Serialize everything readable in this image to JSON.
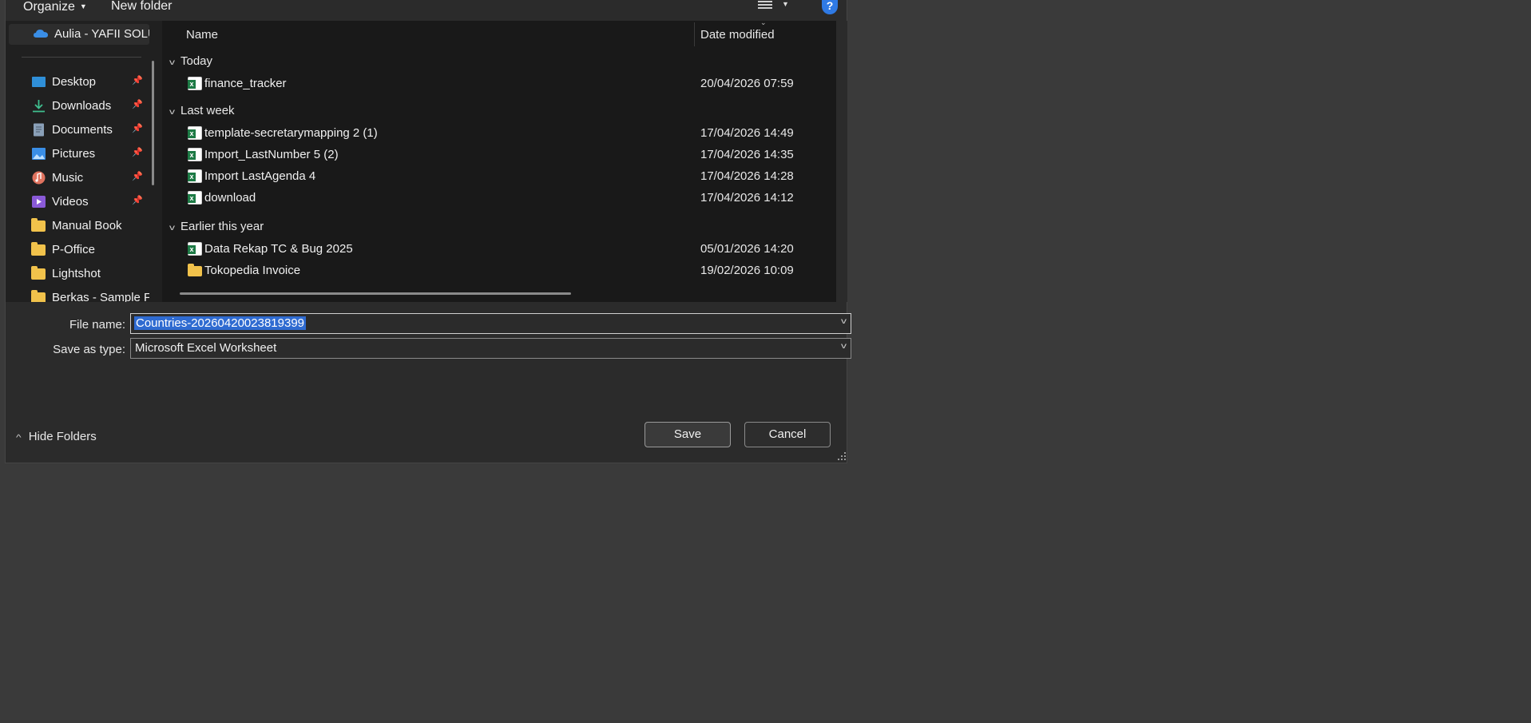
{
  "toolbar": {
    "organize_label": "Organize",
    "new_folder_label": "New folder",
    "help_label": "?"
  },
  "nav": {
    "onedrive_label": "Aulia - YAFII SOLU",
    "items": [
      {
        "label": "Desktop",
        "icon": "desktop-icon",
        "pinned": true
      },
      {
        "label": "Downloads",
        "icon": "download-icon",
        "pinned": true
      },
      {
        "label": "Documents",
        "icon": "documents-icon",
        "pinned": true
      },
      {
        "label": "Pictures",
        "icon": "pictures-icon",
        "pinned": true
      },
      {
        "label": "Music",
        "icon": "music-icon",
        "pinned": true
      },
      {
        "label": "Videos",
        "icon": "videos-icon",
        "pinned": true
      },
      {
        "label": "Manual Book",
        "icon": "folder-icon",
        "pinned": false
      },
      {
        "label": "P-Office",
        "icon": "folder-icon",
        "pinned": false
      },
      {
        "label": "Lightshot",
        "icon": "folder-icon",
        "pinned": false
      },
      {
        "label": "Berkas - Sample F",
        "icon": "folder-icon",
        "pinned": false
      }
    ]
  },
  "list": {
    "columns": {
      "name": "Name",
      "date_modified": "Date modified"
    },
    "groups": [
      {
        "label": "Today",
        "rows": [
          {
            "name": "finance_tracker",
            "date": "20/04/2026 07:59",
            "type": "excel"
          }
        ]
      },
      {
        "label": "Last week",
        "rows": [
          {
            "name": "template-secretarymapping 2 (1)",
            "date": "17/04/2026 14:49",
            "type": "excel"
          },
          {
            "name": "Import_LastNumber 5 (2)",
            "date": "17/04/2026 14:35",
            "type": "excel"
          },
          {
            "name": "Import LastAgenda 4",
            "date": "17/04/2026 14:28",
            "type": "excel"
          },
          {
            "name": "download",
            "date": "17/04/2026 14:12",
            "type": "excel"
          }
        ]
      },
      {
        "label": "Earlier this year",
        "rows": [
          {
            "name": "Data Rekap TC & Bug 2025",
            "date": "05/01/2026 14:20",
            "type": "excel"
          },
          {
            "name": "Tokopedia Invoice",
            "date": "19/02/2026 10:09",
            "type": "folder"
          }
        ]
      }
    ]
  },
  "form": {
    "file_name_label": "File name:",
    "file_name_value": "Countries-20260420023819399",
    "save_type_label": "Save as type:",
    "save_type_value": "Microsoft Excel Worksheet"
  },
  "footer": {
    "hide_folders_label": "Hide Folders",
    "save_label": "Save",
    "cancel_label": "Cancel"
  },
  "colors": {
    "selection": "#2f6bd1",
    "excel_green": "#1d7a45",
    "folder_yellow": "#f1c24b",
    "help_blue": "#2f7ae5"
  }
}
